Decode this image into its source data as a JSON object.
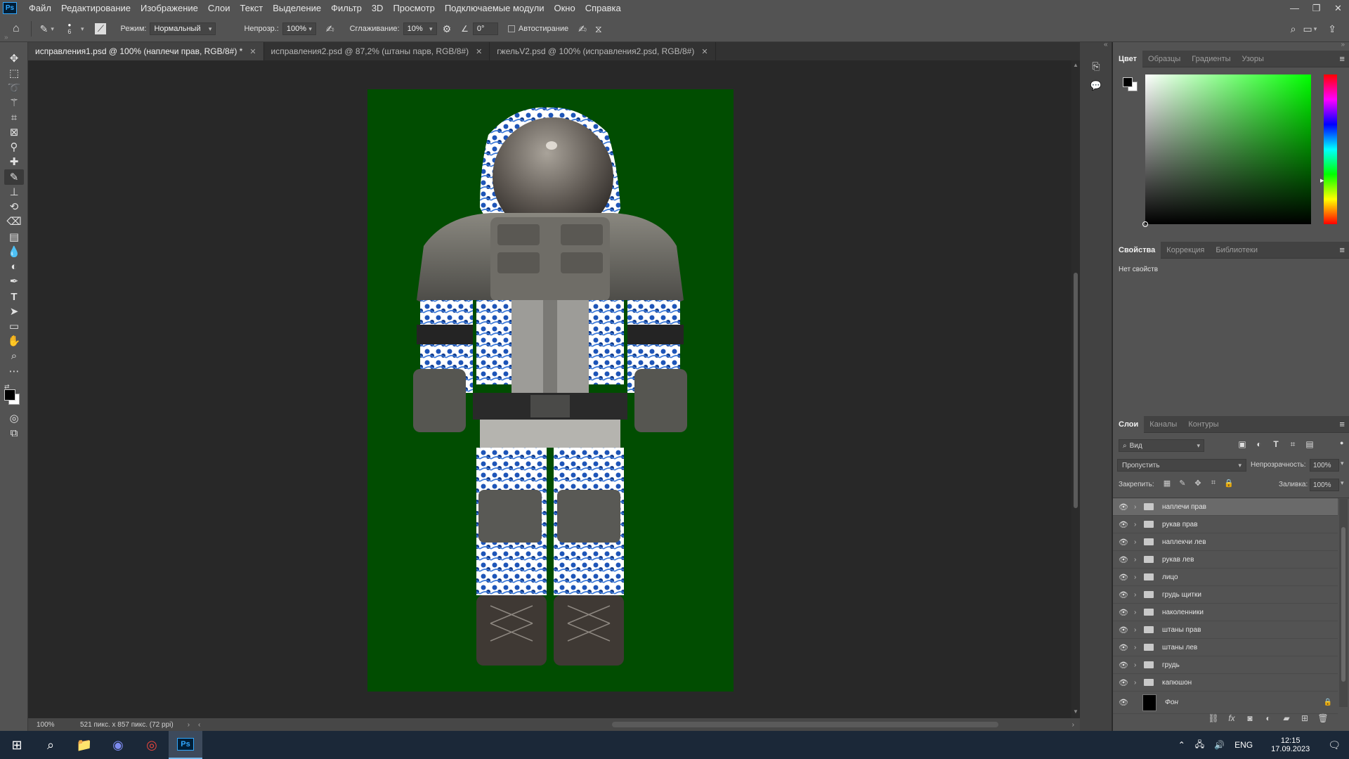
{
  "menubar": {
    "app_icon": "Ps",
    "items": [
      "Файл",
      "Редактирование",
      "Изображение",
      "Слои",
      "Текст",
      "Выделение",
      "Фильтр",
      "3D",
      "Просмотр",
      "Подключаемые модули",
      "Окно",
      "Справка"
    ],
    "window_buttons": [
      "—",
      "❐",
      "✕"
    ]
  },
  "options": {
    "brush_size": "6",
    "mode_label": "Режим:",
    "mode_value": "Нормальный",
    "opacity_label": "Непрозр.:",
    "opacity_value": "100%",
    "smoothing_label": "Сглаживание:",
    "smoothing_value": "10%",
    "angle_value": "0°",
    "autoerase_label": "Автостирание"
  },
  "tabs": [
    {
      "label": "исправления1.psd @ 100% (наплечи прав, RGB/8#) *"
    },
    {
      "label": "исправления2.psd @ 87,2% (штаны парв, RGB/8#)"
    },
    {
      "label": "гжельV2.psd @ 100% (исправления2.psd, RGB/8#)"
    }
  ],
  "status": {
    "zoom": "100%",
    "doc_info": "521 пикс. x 857 пикс. (72 ppi)"
  },
  "color_panel": {
    "tabs": [
      "Цвет",
      "Образцы",
      "Градиенты",
      "Узоры"
    ],
    "hue_color": "#00ff00"
  },
  "props_panel": {
    "tabs": [
      "Свойства",
      "Коррекция",
      "Библиотеки"
    ],
    "empty_text": "Нет свойств"
  },
  "layers_panel": {
    "tabs": [
      "Слои",
      "Каналы",
      "Контуры"
    ],
    "filter_label": "Вид",
    "blend_mode": "Пропустить",
    "opacity_label": "Непрозрачность:",
    "opacity_value": "100%",
    "lock_label": "Закрепить:",
    "fill_label": "Заливка:",
    "fill_value": "100%",
    "layers": [
      {
        "name": "наплечи прав"
      },
      {
        "name": "рукав прав"
      },
      {
        "name": "наплекчи лев"
      },
      {
        "name": "рукав лев"
      },
      {
        "name": "лицо"
      },
      {
        "name": "грудь щитки"
      },
      {
        "name": "наколенники"
      },
      {
        "name": "штаны прав"
      },
      {
        "name": "штаны лев"
      },
      {
        "name": "грудь"
      },
      {
        "name": "капюшон"
      }
    ],
    "background_layer": "Фон"
  },
  "taskbar": {
    "lang": "ENG",
    "time": "12:15",
    "date": "17.09.2023"
  },
  "canvas": {
    "background_color": "#014d01"
  }
}
